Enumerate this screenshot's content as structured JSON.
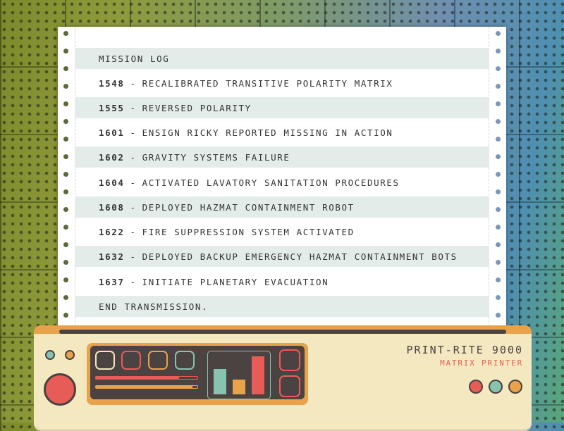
{
  "log": {
    "title": "MISSION LOG",
    "entries": [
      {
        "time": "1548",
        "text": "RECALIBRATED TRANSITIVE POLARITY MATRIX"
      },
      {
        "time": "1555",
        "text": "REVERSED POLARITY"
      },
      {
        "time": "1601",
        "text": "ENSIGN RICKY REPORTED MISSING IN ACTION"
      },
      {
        "time": "1602",
        "text": "GRAVITY SYSTEMS FAILURE"
      },
      {
        "time": "1604",
        "text": "ACTIVATED LAVATORY SANITATION PROCEDURES"
      },
      {
        "time": "1608",
        "text": "DEPLOYED HAZMAT CONTAINMENT ROBOT"
      },
      {
        "time": "1622",
        "text": "FIRE SUPPRESSION SYSTEM ACTIVATED"
      },
      {
        "time": "1632",
        "text": "DEPLOYED BACKUP EMERGENCY HAZMAT CONTAINMENT BOTS"
      },
      {
        "time": "1637",
        "text": "INITIATE PLANETARY EVACUATION"
      }
    ],
    "separator": "-",
    "footer": "END TRANSMISSION."
  },
  "printer": {
    "brand": "PRINT-RITE 9000",
    "subtitle": "MATRIX PRINTER",
    "bar_levels": [
      0.66,
      0.38,
      1.0
    ],
    "progress": [
      0.82,
      0.95
    ]
  },
  "colors": {
    "red": "#e85c58",
    "teal": "#86c4b0",
    "orange": "#e8a24a",
    "dark": "#4b4242",
    "cream": "#f3e8c0",
    "band": "#e3ece9"
  }
}
